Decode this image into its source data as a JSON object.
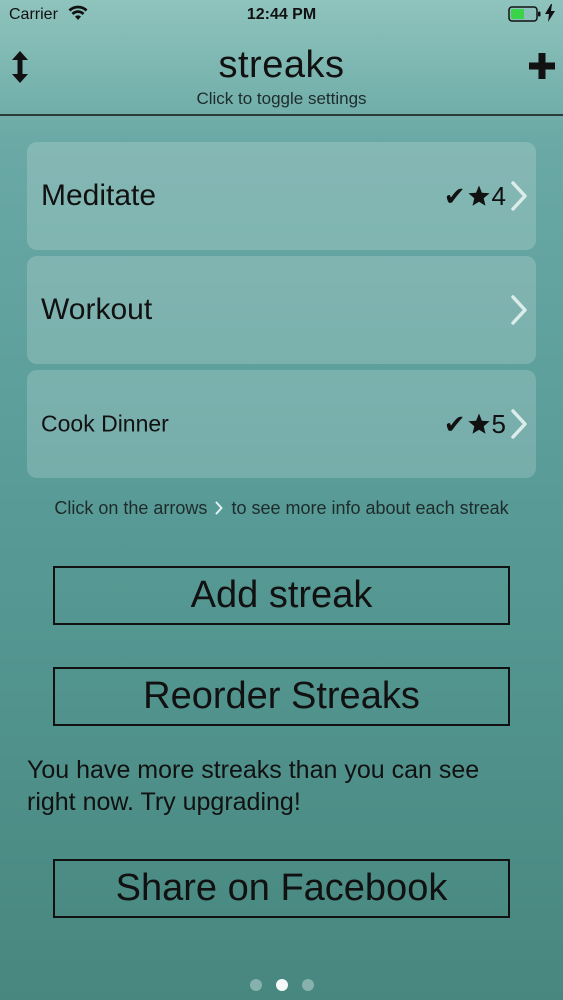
{
  "status_bar": {
    "carrier": "Carrier",
    "time": "12:44 PM",
    "battery_color": "#3bd34a"
  },
  "header": {
    "title": "streaks",
    "subtitle": "Click to toggle settings",
    "left_icon": "vertical-arrows-icon",
    "right_icon": "plus-icon"
  },
  "streaks": [
    {
      "name": "Meditate",
      "completed": true,
      "count": "4"
    },
    {
      "name": "Workout",
      "completed": false,
      "count": ""
    },
    {
      "name": "Cook Dinner",
      "completed": true,
      "count": "5"
    }
  ],
  "hint": {
    "before": "Click on the arrows",
    "after": "to see more info about each streak"
  },
  "buttons": {
    "add_streak": "Add streak",
    "reorder_streaks": "Reorder Streaks",
    "share_facebook": "Share on Facebook"
  },
  "upgrade_message": "You have more streaks than you can see right now. Try upgrading!",
  "pagination": {
    "total": 3,
    "current": 2
  },
  "colors": {
    "accent": "#5a9d99",
    "text": "#111111"
  }
}
